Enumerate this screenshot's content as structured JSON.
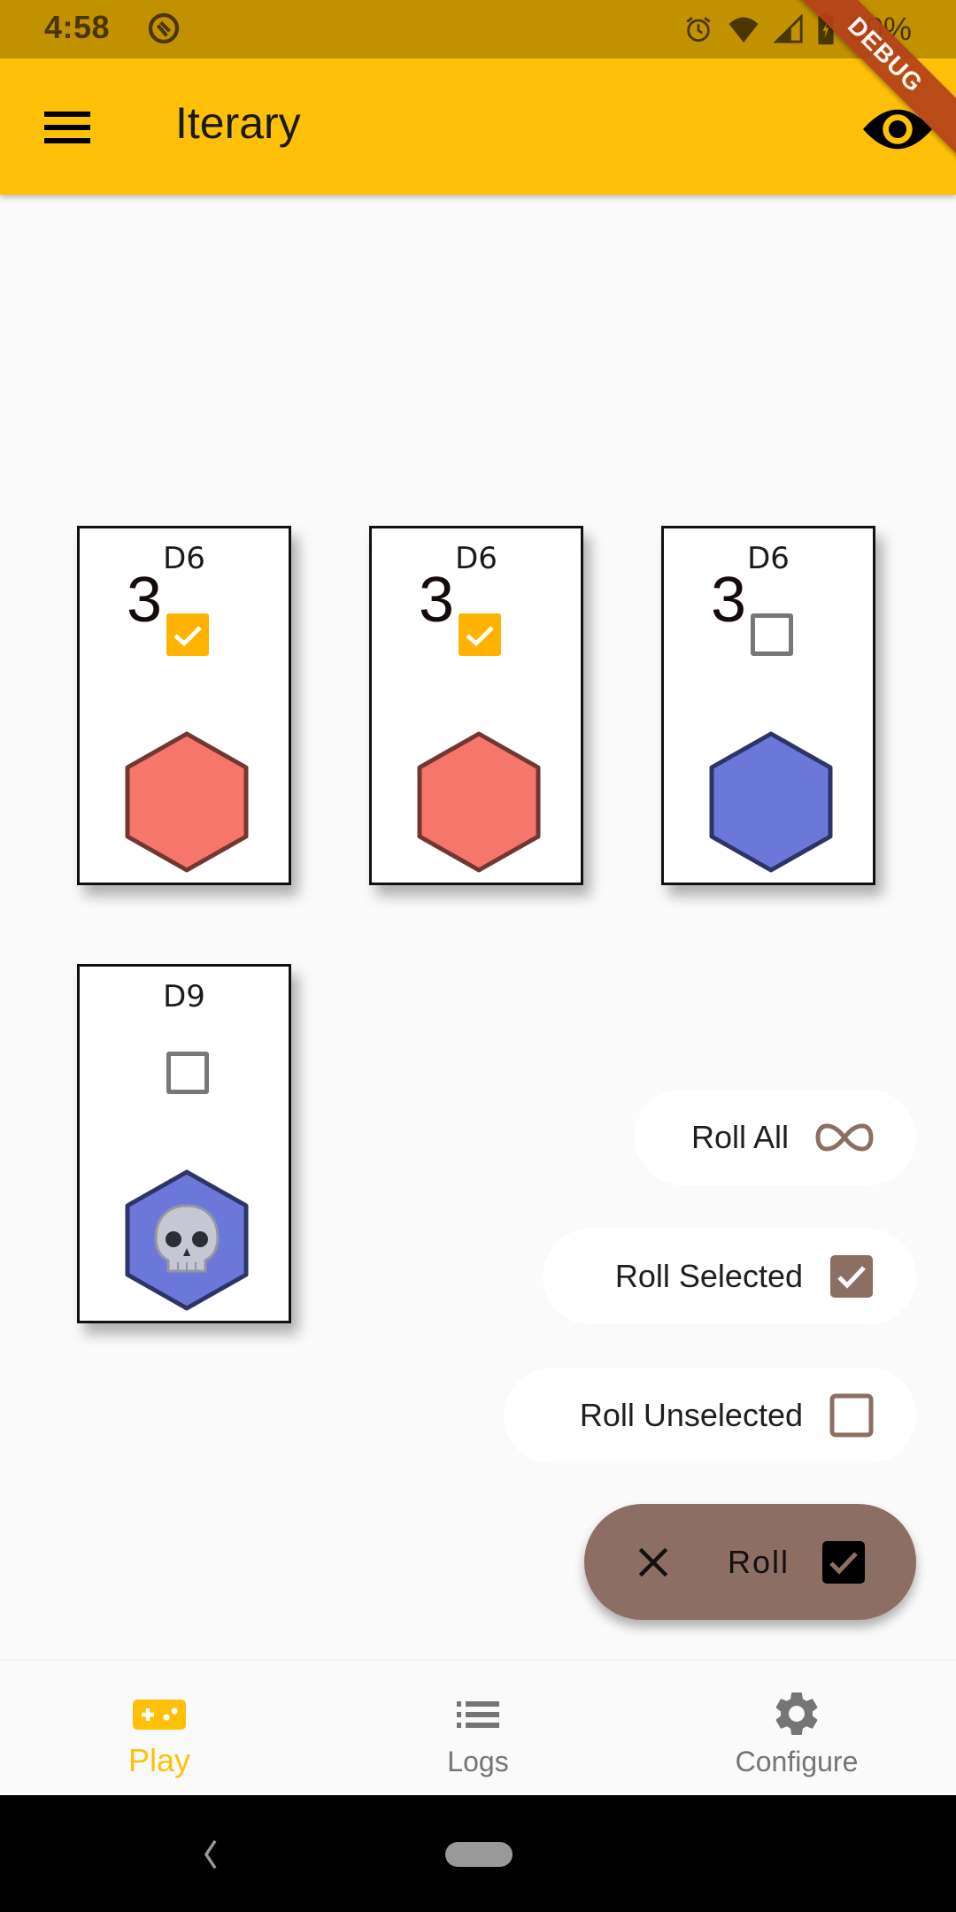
{
  "status_bar": {
    "time": "4:58",
    "battery_percent": "90%",
    "icons": [
      "at-sign-icon",
      "alarm-icon",
      "wifi-icon",
      "cell-signal-icon",
      "battery-charging-icon"
    ]
  },
  "app_bar": {
    "title": "Iterary",
    "menu_icon": "hamburger-menu-icon",
    "action_icon": "eye-icon",
    "debug_banner": "DEBUG"
  },
  "colors": {
    "primary": "#ffc107",
    "accent_brown": "#8d6e63",
    "selected_checkbox": "#ffb300",
    "die_selected_fill": "#f6766b",
    "die_selected_stroke": "#733732",
    "die_unselected_fill": "#6b78da",
    "die_unselected_stroke": "#2d3566"
  },
  "dice": [
    {
      "label": "D6",
      "selected": true,
      "value": "3",
      "face": "number"
    },
    {
      "label": "D6",
      "selected": true,
      "value": "3",
      "face": "number"
    },
    {
      "label": "D6",
      "selected": false,
      "value": "3",
      "face": "number"
    },
    {
      "label": "D9",
      "selected": false,
      "value": "💀",
      "face": "skull"
    }
  ],
  "speed_dial": {
    "roll_all": {
      "label": "Roll All",
      "icon": "infinity-icon"
    },
    "roll_selected": {
      "label": "Roll Selected",
      "icon": "checkbox-checked-icon"
    },
    "roll_unselected": {
      "label": "Roll Unselected",
      "icon": "checkbox-empty-icon"
    },
    "main": {
      "label": "Roll",
      "close_icon": "close-icon",
      "icon": "checkbox-checked-icon"
    }
  },
  "bottom_nav": {
    "items": [
      {
        "label": "Play",
        "icon": "gamepad-icon",
        "active": true
      },
      {
        "label": "Logs",
        "icon": "list-icon",
        "active": false
      },
      {
        "label": "Configure",
        "icon": "gear-icon",
        "active": false
      }
    ]
  }
}
